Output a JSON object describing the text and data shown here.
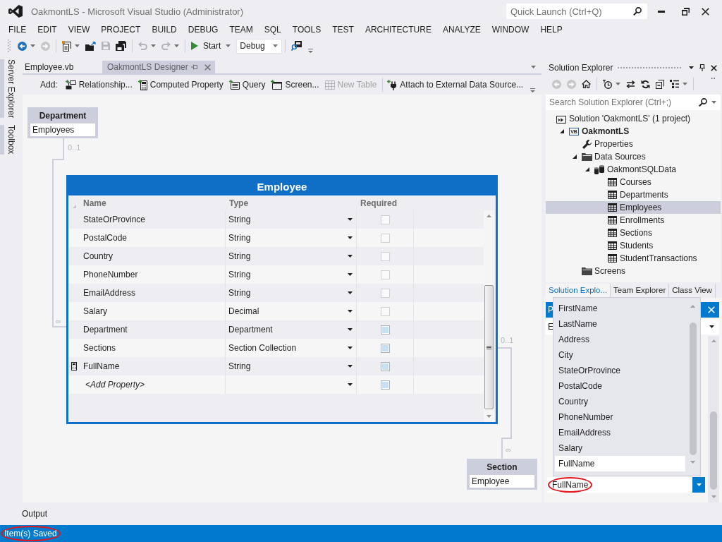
{
  "window": {
    "title": "OakmontLS - Microsoft Visual Studio (Administrator)",
    "quick_launch": {
      "placeholder": "Quick Launch (Ctrl+Q)"
    }
  },
  "menu": [
    "FILE",
    "EDIT",
    "VIEW",
    "PROJECT",
    "BUILD",
    "DEBUG",
    "TEAM",
    "SQL",
    "TOOLS",
    "TEST",
    "ARCHITECTURE",
    "ANALYZE",
    "WINDOW",
    "HELP"
  ],
  "toolbar": [
    {
      "kind": "back",
      "disabled": false,
      "dropdown": true
    },
    {
      "kind": "forward",
      "disabled": true,
      "dropdown": false
    },
    {
      "kind": "separator"
    },
    {
      "kind": "new_project",
      "disabled": false,
      "dropdown": true
    },
    {
      "kind": "open",
      "disabled": false,
      "dropdown": false
    },
    {
      "kind": "save",
      "disabled": true,
      "dropdown": false
    },
    {
      "kind": "save_all",
      "disabled": false,
      "dropdown": false
    },
    {
      "kind": "separator"
    },
    {
      "kind": "undo",
      "disabled": true,
      "dropdown": true
    },
    {
      "kind": "redo",
      "disabled": true,
      "dropdown": true
    },
    {
      "kind": "separator"
    },
    {
      "kind": "start",
      "label": "Start",
      "disabled": false,
      "dropdown": true
    },
    {
      "kind": "combo",
      "value": "Debug"
    },
    {
      "kind": "separator"
    },
    {
      "kind": "find",
      "disabled": false,
      "dropdown": false
    }
  ],
  "side_tabs": [
    "Server Explorer",
    "Toolbox"
  ],
  "document_tabs": [
    {
      "label": "Employee.vb",
      "selected": false
    },
    {
      "label": "OakmontLS Designer",
      "selected": true
    }
  ],
  "designer_toolbar": {
    "label": "Add:",
    "items": [
      {
        "kind": "relationship",
        "label": "Relationship...",
        "disabled": false
      },
      {
        "kind": "computed_property",
        "label": "Computed Property",
        "disabled": false
      },
      {
        "kind": "query",
        "label": "Query",
        "disabled": false
      },
      {
        "kind": "screen",
        "label": "Screen...",
        "disabled": false
      },
      {
        "kind": "new_table",
        "label": "New Table",
        "disabled": true
      },
      {
        "kind": "separator"
      },
      {
        "kind": "attach",
        "label": "Attach to External Data Source...",
        "disabled": false
      }
    ]
  },
  "canvas": {
    "entities": [
      {
        "title": "Department",
        "rows": [
          "Employees"
        ]
      },
      {
        "title": "Section",
        "rows": [
          "Employee"
        ]
      }
    ],
    "relationships": [
      {
        "one_end": "0..1",
        "many_end": "∞"
      },
      {
        "one_end": "0..1",
        "many_end": "∞"
      }
    ],
    "table": {
      "title": "Employee",
      "columns": [
        "Name",
        "Type",
        "Required"
      ],
      "rows": [
        {
          "kind": "property",
          "name": "StateOrProvince",
          "type": "String",
          "required": false,
          "disabled": false,
          "computed": false
        },
        {
          "kind": "property",
          "name": "PostalCode",
          "type": "String",
          "required": false,
          "disabled": false,
          "computed": false
        },
        {
          "kind": "property",
          "name": "Country",
          "type": "String",
          "required": false,
          "disabled": false,
          "computed": false
        },
        {
          "kind": "property",
          "name": "PhoneNumber",
          "type": "String",
          "required": false,
          "disabled": false,
          "computed": false
        },
        {
          "kind": "property",
          "name": "EmailAddress",
          "type": "String",
          "required": false,
          "disabled": false,
          "computed": false
        },
        {
          "kind": "property",
          "name": "Salary",
          "type": "Decimal",
          "required": false,
          "disabled": false,
          "computed": false
        },
        {
          "kind": "property",
          "name": "Department",
          "type": "Department",
          "required": false,
          "disabled": true,
          "computed": false
        },
        {
          "kind": "property",
          "name": "Sections",
          "type": "Section Collection",
          "required": false,
          "disabled": true,
          "computed": false
        },
        {
          "kind": "property",
          "name": "FullName",
          "type": "String",
          "required": false,
          "disabled": true,
          "computed": true
        },
        {
          "kind": "new",
          "name": "<Add Property>",
          "required": false,
          "disabled": true,
          "computed": false
        }
      ]
    }
  },
  "solution_explorer": {
    "title": "Solution Explorer",
    "toolbar": [
      {
        "kind": "back",
        "disabled": true,
        "dropdown": false
      },
      {
        "kind": "forward",
        "disabled": true,
        "dropdown": false
      },
      {
        "kind": "home",
        "disabled": false,
        "dropdown": false
      },
      {
        "kind": "separator"
      },
      {
        "kind": "history",
        "disabled": false,
        "dropdown": true
      },
      {
        "kind": "sync",
        "disabled": false,
        "dropdown": false
      },
      {
        "kind": "refresh",
        "disabled": false,
        "dropdown": false
      },
      {
        "kind": "collapse_all",
        "disabled": false,
        "dropdown": false
      },
      {
        "kind": "properties",
        "disabled": false,
        "dropdown": true
      },
      {
        "kind": "separator"
      }
    ],
    "search": {
      "placeholder": "Search Solution Explorer (Ctrl+;)"
    },
    "tree": [
      {
        "label": "Solution 'OakmontLS' (1 project)",
        "kind": "solution",
        "selected": false,
        "children": [
          {
            "label": "OakmontLS",
            "kind": "project",
            "badge": "VB",
            "expanded": true,
            "selected": false,
            "children": [
              {
                "label": "Properties",
                "kind": "properties",
                "selected": false
              },
              {
                "label": "Data Sources",
                "kind": "folder",
                "expanded": true,
                "selected": false,
                "children": [
                  {
                    "label": "OakmontSQLData",
                    "kind": "database",
                    "expanded": true,
                    "selected": false,
                    "children": [
                      {
                        "label": "Courses",
                        "kind": "table",
                        "selected": false
                      },
                      {
                        "label": "Departments",
                        "kind": "table",
                        "selected": false
                      },
                      {
                        "label": "Employees",
                        "kind": "table",
                        "selected": true
                      },
                      {
                        "label": "Enrollments",
                        "kind": "table",
                        "selected": false
                      },
                      {
                        "label": "Sections",
                        "kind": "table",
                        "selected": false
                      },
                      {
                        "label": "Students",
                        "kind": "table",
                        "selected": false
                      },
                      {
                        "label": "StudentTransactions",
                        "kind": "table",
                        "selected": false
                      }
                    ]
                  }
                ]
              },
              {
                "label": "Screens",
                "kind": "folder",
                "selected": false
              }
            ]
          }
        ]
      }
    ],
    "tabs": [
      {
        "label": "Solution Explo...",
        "selected": true
      },
      {
        "label": "Team Explorer",
        "selected": false
      },
      {
        "label": "Class View",
        "selected": false
      }
    ]
  },
  "properties": {
    "title": "P",
    "object": "E",
    "summary_property": {
      "value": "FullName",
      "highlighted": true
    },
    "dropdown": [
      {
        "label": "FirstName",
        "selected": false
      },
      {
        "label": "LastName",
        "selected": false
      },
      {
        "label": "Address",
        "selected": false
      },
      {
        "label": "City",
        "selected": false
      },
      {
        "label": "StateOrProvince",
        "selected": false
      },
      {
        "label": "PostalCode",
        "selected": false
      },
      {
        "label": "Country",
        "selected": false
      },
      {
        "label": "PhoneNumber",
        "selected": false
      },
      {
        "label": "EmailAddress",
        "selected": false
      },
      {
        "label": "Salary",
        "selected": false
      },
      {
        "label": "FullName",
        "selected": true
      }
    ]
  },
  "output_panel": {
    "tab": "Output"
  },
  "status_bar": {
    "text": "Item(s) Saved",
    "highlighted": true
  }
}
